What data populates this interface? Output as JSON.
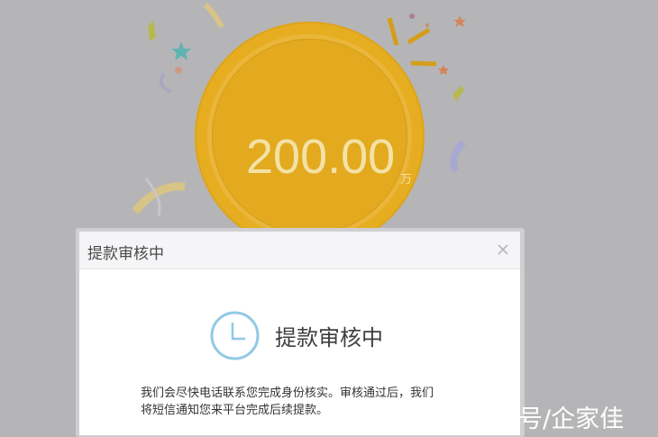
{
  "reward": {
    "amount": "200.00",
    "unit": "万"
  },
  "dialog": {
    "title": "提款审核中",
    "close_symbol": "×",
    "status_label": "提款审核中",
    "message_line1": "我们会尽快电话联系您完成身份核实。审核通过后，我们",
    "message_line2": "将短信通知您来平台完成后续提款。"
  },
  "watermark": "家号/企家佳",
  "colors": {
    "overlay": "#b5b5b7",
    "coin": "#e6ad20",
    "clock_accent": "#92c9e6"
  }
}
